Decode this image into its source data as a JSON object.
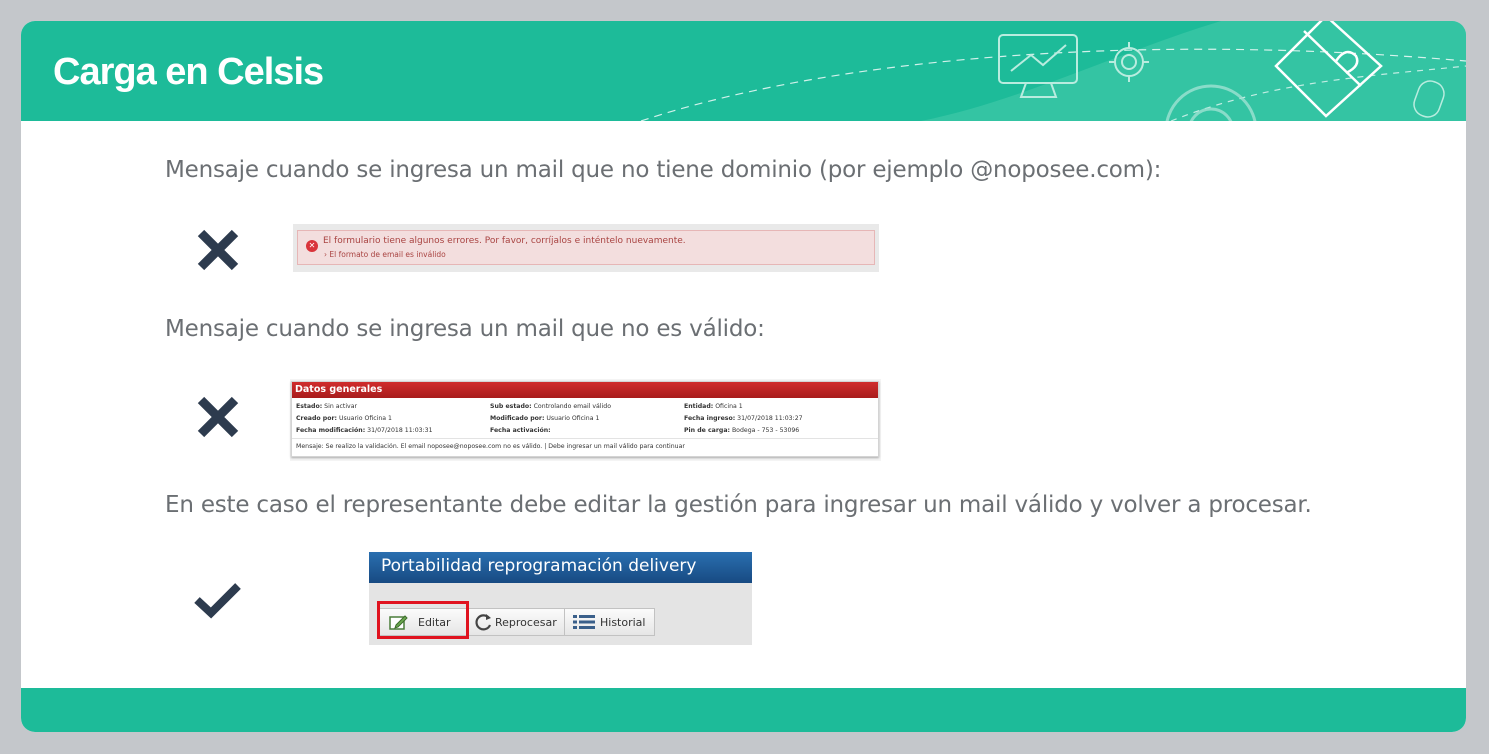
{
  "header": {
    "title": "Carga en Celsis"
  },
  "section1": {
    "text": "Mensaje cuando se ingresa un mail que no tiene dominio (por ejemplo @noposee.com):",
    "mark": "cross-icon",
    "screenshot": {
      "error_title": "El formulario tiene algunos errores. Por favor, corríjalos e inténtelo nuevamente.",
      "error_detail": "El formato de email es inválido"
    }
  },
  "section2": {
    "text": "Mensaje cuando se ingresa un mail que no es válido:",
    "mark": "cross-icon",
    "screenshot": {
      "panel_title": "Datos generales",
      "rows": [
        {
          "k1": "Estado:",
          "v1": "Sin activar",
          "k2": "Sub estado:",
          "v2": "Controlando email válido",
          "k3": "Entidad:",
          "v3": "Oficina 1"
        },
        {
          "k1": "Creado por:",
          "v1": "Usuario Oficina 1",
          "k2": "Modificado por:",
          "v2": "Usuario Oficina 1",
          "k3": "Fecha ingreso:",
          "v3": "31/07/2018 11:03:27"
        },
        {
          "k1": "Fecha modificación:",
          "v1": "31/07/2018 11:03:31",
          "k2": "Fecha activación:",
          "v2": "",
          "k3": "Pin de carga:",
          "v3": "Bodega - 753 - 53096"
        }
      ],
      "message_label": "Mensaje:",
      "message": "Se realizo la validación. El email noposee@noposee.com no es válido. | Debe ingresar un mail válido para continuar"
    }
  },
  "section3": {
    "text": "En este caso el representante debe editar la gestión para ingresar un mail válido y volver a procesar.",
    "mark": "check-icon",
    "screenshot": {
      "header": "Portabilidad reprogramación delivery",
      "buttons": [
        {
          "label": "Editar",
          "icon": "edit-icon"
        },
        {
          "label": "Reprocesar",
          "icon": "refresh-icon"
        },
        {
          "label": "Historial",
          "icon": "list-icon"
        }
      ]
    }
  },
  "colors": {
    "accent": "#1dbb99",
    "mark": "#2d3b4e",
    "error": "#a94442",
    "highlight": "#e0131f"
  }
}
